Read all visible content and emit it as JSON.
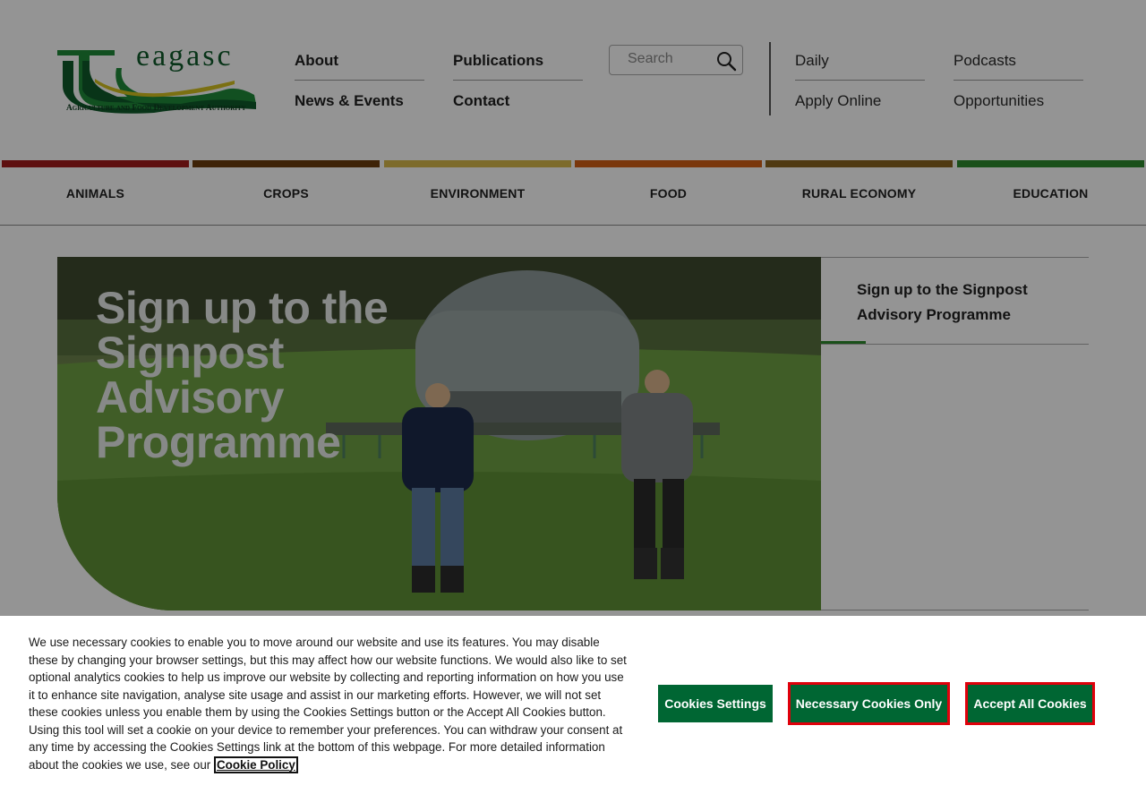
{
  "brand": {
    "wordmark": "eagasc",
    "tagline": "Agriculture and Food Development Authority"
  },
  "nav": {
    "main": [
      "About",
      "Publications",
      "News & Events",
      "Contact"
    ],
    "utility": [
      "Daily",
      "Podcasts",
      "Apply Online",
      "Opportunities"
    ]
  },
  "search": {
    "placeholder": "Search",
    "icon": "search-icon"
  },
  "categories": [
    {
      "label": "ANIMALS",
      "color": "#a31c1c"
    },
    {
      "label": "CROPS",
      "color": "#6b3d0d"
    },
    {
      "label": "ENVIRONMENT",
      "color": "#d7b84a"
    },
    {
      "label": "FOOD",
      "color": "#d35f16"
    },
    {
      "label": "RURAL ECONOMY",
      "color": "#8a6420"
    },
    {
      "label": "EDUCATION",
      "color": "#2e8b2e"
    }
  ],
  "hero": {
    "title": "Sign up to the Signpost Advisory Programme"
  },
  "side_panel": {
    "item": "Sign up to the Signpost Advisory Programme"
  },
  "cookie": {
    "text": "We use necessary cookies to enable you to move around our website and use its features. You may disable these by changing your browser settings, but this may affect how our website functions. We would also like to set optional analytics cookies to help us improve our website by collecting and reporting information on how you use it to enhance site navigation, analyse site usage and assist in our marketing efforts. However, we will not set these cookies unless you enable them by using the Cookies Settings button or the Accept All Cookies button. Using this tool will set a cookie on your device to remember your preferences. You can withdraw your consent at any time by accessing the Cookies Settings link at the bottom of this webpage. For more detailed information about the cookies we use, see our",
    "policy_link": "Cookie Policy",
    "buttons": {
      "settings": "Cookies Settings",
      "necessary": "Necessary Cookies Only",
      "accept": "Accept All Cookies"
    }
  },
  "colors": {
    "brand_green": "#006633",
    "highlight_red": "#e0000b"
  }
}
